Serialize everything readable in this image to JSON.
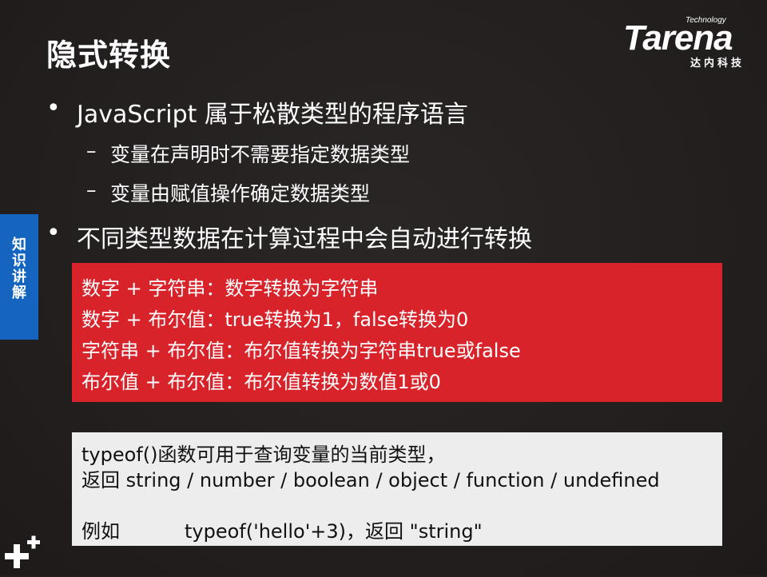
{
  "slide": {
    "title": "隐式转换",
    "logo": {
      "technology": "Technology",
      "brand": "Tarena",
      "subtitle": "达内科技"
    },
    "side_tab": "知识讲解",
    "bullets": [
      {
        "text": "JavaScript 属于松散类型的程序语言",
        "sub": [
          "变量在声明时不需要指定数据类型",
          "变量由赋值操作确定数据类型"
        ]
      },
      {
        "text": "不同类型数据在计算过程中会自动进行转换",
        "sub": []
      }
    ],
    "bullet_symbol": "•",
    "dash_symbol": "–",
    "rules_box": [
      "数字 + 字符串：数字转换为字符串",
      "数字 + 布尔值：true转换为1，false转换为0",
      "字符串 + 布尔值：布尔值转换为字符串true或false",
      "布尔值 + 布尔值：布尔值转换为数值1或0"
    ],
    "typeof_box": {
      "line1": "typeof()函数可用于查询变量的当前类型，",
      "line2": "返回 string / number / boolean / object / function / undefined",
      "example_label": "例如",
      "example_code": "typeof('hello'+3)，返回 \"string\""
    },
    "colors": {
      "background": "#241f1f",
      "accent_red": "#d9232b",
      "side_tab_blue": "#1565c0",
      "gray_box": "#ededed"
    },
    "icons": [
      "plus-plus-icon"
    ]
  }
}
